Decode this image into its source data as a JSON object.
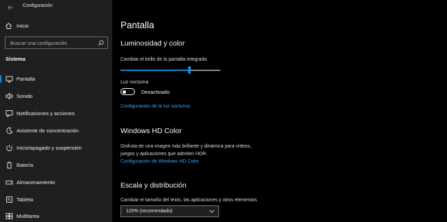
{
  "window": {
    "title": "Configuración"
  },
  "sidebar": {
    "home_label": "Inicio",
    "search_placeholder": "Buscar una configuración",
    "section_title": "Sistema",
    "items": [
      {
        "label": "Pantalla",
        "icon": "monitor-icon",
        "selected": true
      },
      {
        "label": "Sonido",
        "icon": "speaker-icon",
        "selected": false
      },
      {
        "label": "Notificaciones y acciones",
        "icon": "notification-icon",
        "selected": false
      },
      {
        "label": "Asistente de concentración",
        "icon": "moon-icon",
        "selected": false
      },
      {
        "label": "Inicio/apagado y suspensión",
        "icon": "power-icon",
        "selected": false
      },
      {
        "label": "Batería",
        "icon": "battery-icon",
        "selected": false
      },
      {
        "label": "Almacenamiento",
        "icon": "storage-icon",
        "selected": false
      },
      {
        "label": "Tableta",
        "icon": "tablet-icon",
        "selected": false
      },
      {
        "label": "Multitarea",
        "icon": "multitask-icon",
        "selected": false
      }
    ]
  },
  "main": {
    "page_title": "Pantalla",
    "brightness": {
      "heading": "Luminosidad y color",
      "slider_label": "Cambiar el brillo de la pantalla integrada",
      "slider_value": 0.69
    },
    "night_light": {
      "label": "Luz nocturna",
      "state_text": "Desactivado",
      "settings_link": "Configuración de la luz nocturna"
    },
    "hd_color": {
      "heading": "Windows HD Color",
      "description_line1": "Disfruta de una imagen más brillante y dinámica para vídeos,",
      "description_line2": "juegos y aplicaciones que admiten HDR.",
      "settings_link": "Configuración de Windows HD Color"
    },
    "scale": {
      "heading": "Escala y distribución",
      "label": "Cambiar el tamaño del texto, las aplicaciones y otros elementos",
      "selected_value": "125% (recomendado)"
    }
  },
  "colors": {
    "accent": "#1a8ad4",
    "link": "#3ea0e8",
    "sidebar_bg": "#1f1f1f",
    "main_bg": "#000000"
  }
}
